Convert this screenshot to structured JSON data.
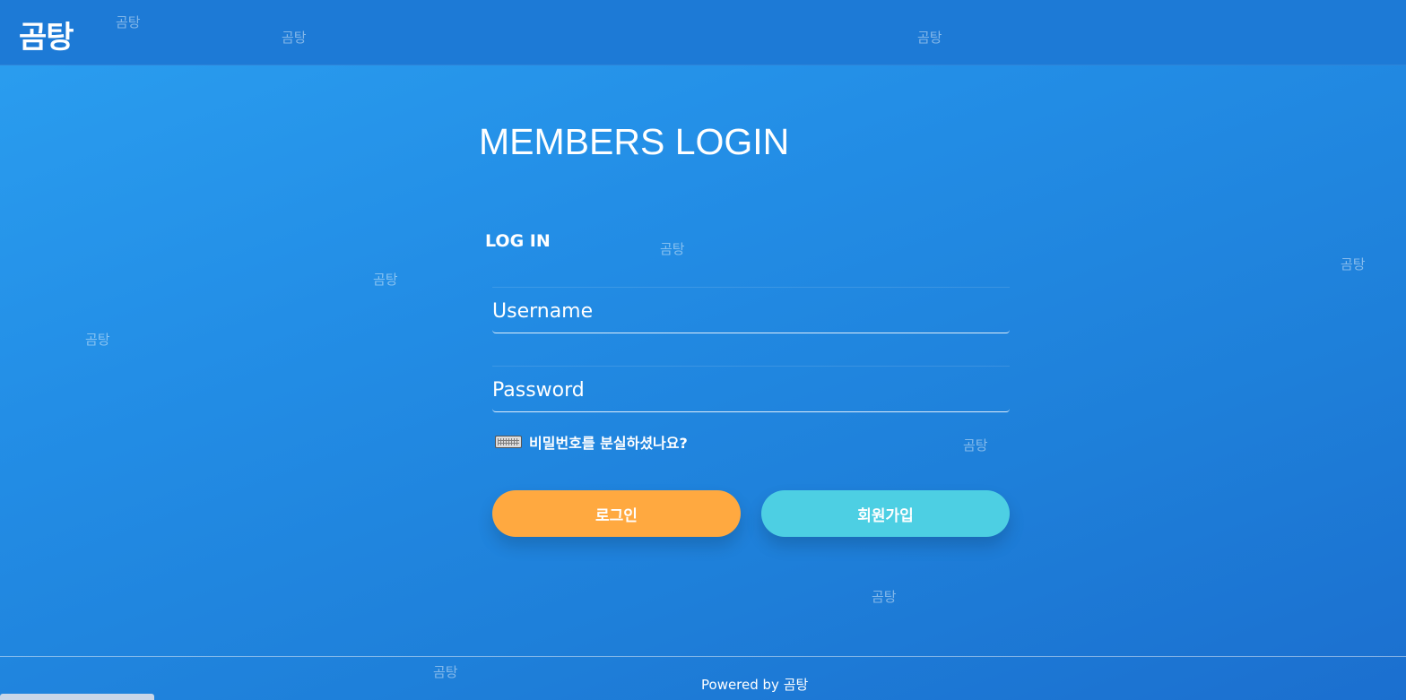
{
  "header": {
    "brand": "곰탕"
  },
  "watermark_text": "곰탕",
  "login": {
    "title": "MEMBERS LOGIN",
    "section_label": "LOG IN",
    "username_placeholder": "Username",
    "password_placeholder": "Password",
    "forgot_password": "비밀번호를 분실하셨나요?",
    "login_button": "로그인",
    "signup_button": "회원가입"
  },
  "footer": {
    "powered_by": "Powered by 곰탕"
  },
  "colors": {
    "login_button": "#ffa940",
    "signup_button": "#4dcfe3",
    "header": "#1d7ad6"
  },
  "icons": {
    "forgot_password_icon": "keyboard-icon"
  }
}
